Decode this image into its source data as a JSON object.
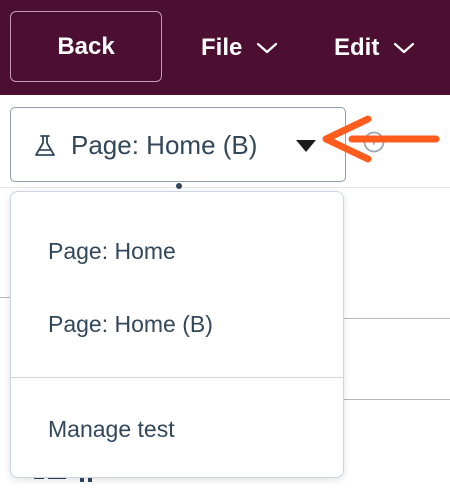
{
  "toolbar": {
    "back_label": "Back",
    "file_label": "File",
    "edit_label": "Edit"
  },
  "variant_selector": {
    "label": "Page: Home (B)"
  },
  "dropdown": {
    "items": [
      {
        "label": "Page: Home"
      },
      {
        "label": "Page: Home (B)"
      }
    ],
    "manage_label": "Manage test"
  },
  "colors": {
    "toolbar_bg": "#4c0f31",
    "arrow": "#ff5c1e",
    "text": "#33475b"
  },
  "icons": {
    "flask": "flask-icon",
    "caret": "caret-down-icon",
    "chevron": "chevron-down-icon",
    "arrow": "annotation-arrow"
  }
}
